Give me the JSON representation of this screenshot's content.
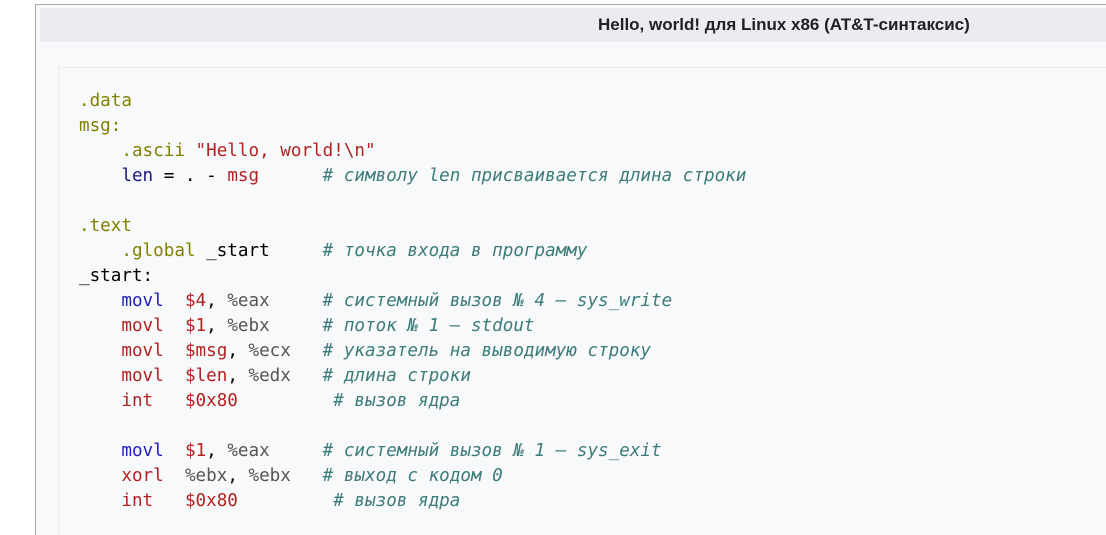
{
  "window": {
    "title": "Hello, world! для Linux x86 (AT&T-синтаксис)"
  },
  "code": {
    "lines": [
      {
        "parts": [
          {
            "t": ".data",
            "c": "directive"
          }
        ]
      },
      {
        "parts": [
          {
            "t": "msg:",
            "c": "label"
          }
        ]
      },
      {
        "parts": [
          {
            "t": "    ",
            "c": "op"
          },
          {
            "t": ".ascii ",
            "c": "directive"
          },
          {
            "t": "\"Hello, world!\\n\"",
            "c": "str"
          }
        ]
      },
      {
        "parts": [
          {
            "t": "    ",
            "c": "op"
          },
          {
            "t": "len",
            "c": "sym"
          },
          {
            "t": " = . - ",
            "c": "op"
          },
          {
            "t": "msg",
            "c": "kw"
          },
          {
            "t": "      ",
            "c": "op"
          },
          {
            "t": "# символу len присваивается длина строки",
            "c": "comment"
          }
        ]
      },
      {
        "parts": [
          {
            "t": "",
            "c": "op"
          }
        ]
      },
      {
        "parts": [
          {
            "t": ".text",
            "c": "directive"
          }
        ]
      },
      {
        "parts": [
          {
            "t": "    ",
            "c": "op"
          },
          {
            "t": ".global ",
            "c": "directive"
          },
          {
            "t": "_start",
            "c": "op"
          },
          {
            "t": "     ",
            "c": "op"
          },
          {
            "t": "# точка входа в программу",
            "c": "comment"
          }
        ]
      },
      {
        "parts": [
          {
            "t": "_start:",
            "c": "op"
          }
        ]
      },
      {
        "parts": [
          {
            "t": "    ",
            "c": "op"
          },
          {
            "t": "movl",
            "c": "kw-blue"
          },
          {
            "t": "  ",
            "c": "op"
          },
          {
            "t": "$4",
            "c": "imm"
          },
          {
            "t": ", ",
            "c": "op"
          },
          {
            "t": "%eax",
            "c": "reg"
          },
          {
            "t": "     ",
            "c": "op"
          },
          {
            "t": "# системный вызов № 4 — sys_write",
            "c": "comment"
          }
        ]
      },
      {
        "parts": [
          {
            "t": "    ",
            "c": "op"
          },
          {
            "t": "movl",
            "c": "kw"
          },
          {
            "t": "  ",
            "c": "op"
          },
          {
            "t": "$1",
            "c": "imm"
          },
          {
            "t": ", ",
            "c": "op"
          },
          {
            "t": "%ebx",
            "c": "reg"
          },
          {
            "t": "     ",
            "c": "op"
          },
          {
            "t": "# поток № 1 — stdout",
            "c": "comment"
          }
        ]
      },
      {
        "parts": [
          {
            "t": "    ",
            "c": "op"
          },
          {
            "t": "movl",
            "c": "kw"
          },
          {
            "t": "  ",
            "c": "op"
          },
          {
            "t": "$msg",
            "c": "imm"
          },
          {
            "t": ", ",
            "c": "op"
          },
          {
            "t": "%ecx",
            "c": "reg"
          },
          {
            "t": "   ",
            "c": "op"
          },
          {
            "t": "# указатель на выводимую строку",
            "c": "comment"
          }
        ]
      },
      {
        "parts": [
          {
            "t": "    ",
            "c": "op"
          },
          {
            "t": "movl",
            "c": "kw"
          },
          {
            "t": "  ",
            "c": "op"
          },
          {
            "t": "$len",
            "c": "imm"
          },
          {
            "t": ", ",
            "c": "op"
          },
          {
            "t": "%edx",
            "c": "reg"
          },
          {
            "t": "   ",
            "c": "op"
          },
          {
            "t": "# длина строки",
            "c": "comment"
          }
        ]
      },
      {
        "parts": [
          {
            "t": "    ",
            "c": "op"
          },
          {
            "t": "int",
            "c": "kw"
          },
          {
            "t": "   ",
            "c": "op"
          },
          {
            "t": "$0x80",
            "c": "imm"
          },
          {
            "t": "         ",
            "c": "op"
          },
          {
            "t": "# вызов ядра",
            "c": "comment"
          }
        ]
      },
      {
        "parts": [
          {
            "t": "",
            "c": "op"
          }
        ]
      },
      {
        "parts": [
          {
            "t": "    ",
            "c": "op"
          },
          {
            "t": "movl",
            "c": "kw-blue"
          },
          {
            "t": "  ",
            "c": "op"
          },
          {
            "t": "$1",
            "c": "imm"
          },
          {
            "t": ", ",
            "c": "op"
          },
          {
            "t": "%eax",
            "c": "reg"
          },
          {
            "t": "     ",
            "c": "op"
          },
          {
            "t": "# системный вызов № 1 — sys_exit",
            "c": "comment"
          }
        ]
      },
      {
        "parts": [
          {
            "t": "    ",
            "c": "op"
          },
          {
            "t": "xorl",
            "c": "kw"
          },
          {
            "t": "  ",
            "c": "op"
          },
          {
            "t": "%ebx",
            "c": "reg"
          },
          {
            "t": ", ",
            "c": "op"
          },
          {
            "t": "%ebx",
            "c": "reg"
          },
          {
            "t": "   ",
            "c": "op"
          },
          {
            "t": "# выход с кодом 0",
            "c": "comment"
          }
        ]
      },
      {
        "parts": [
          {
            "t": "    ",
            "c": "op"
          },
          {
            "t": "int",
            "c": "kw"
          },
          {
            "t": "   ",
            "c": "op"
          },
          {
            "t": "$0x80",
            "c": "imm"
          },
          {
            "t": "         ",
            "c": "op"
          },
          {
            "t": "# вызов ядра",
            "c": "comment"
          }
        ]
      }
    ]
  }
}
